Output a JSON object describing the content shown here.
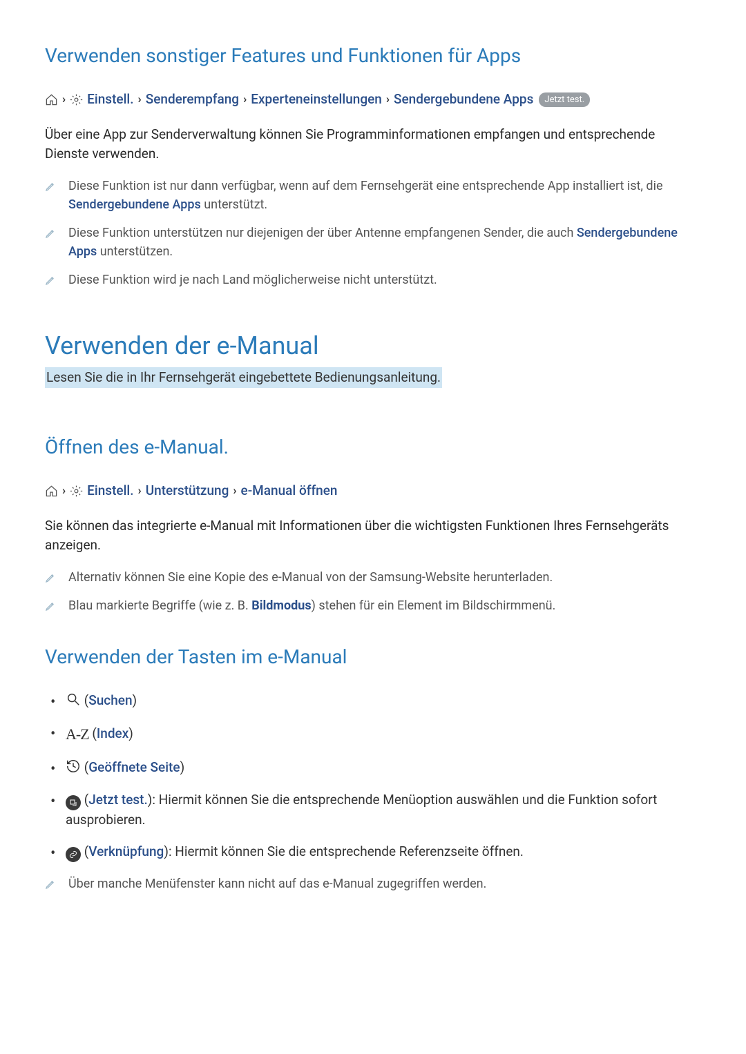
{
  "section1": {
    "title": "Verwenden sonstiger Features und Funktionen für Apps",
    "breadcrumb": {
      "einstell": "Einstell.",
      "senderempfang": "Senderempfang",
      "experten": "Experteneinstellungen",
      "apps": "Sendergebundene Apps",
      "pill": "Jetzt test."
    },
    "body": "Über eine App zur Senderverwaltung können Sie Programminformationen empfangen und entsprechende Dienste verwenden.",
    "notes": {
      "n1_a": "Diese Funktion ist nur dann verfügbar, wenn auf dem Fernsehgerät eine entsprechende App installiert ist, die ",
      "n1_b": "Sendergebundene Apps",
      "n1_c": " unterstützt.",
      "n2_a": "Diese Funktion unterstützen nur diejenigen der über Antenne  empfangenen Sender, die auch ",
      "n2_b": "Sendergebundene Apps",
      "n2_c": " unterstützen.",
      "n3": "Diese Funktion wird je nach Land möglicherweise nicht unterstützt."
    }
  },
  "section2": {
    "title": "Verwenden der e-Manual",
    "subtitle": "Lesen Sie die in Ihr Fernsehgerät eingebettete Bedienungsanleitung."
  },
  "section3": {
    "title": "Öffnen des e-Manual.",
    "breadcrumb": {
      "einstell": "Einstell.",
      "support": "Unterstützung",
      "open": "e-Manual öffnen"
    },
    "body": "Sie können das integrierte e-Manual mit Informationen über die wichtigsten Funktionen Ihres Fernsehgeräts anzeigen.",
    "notes": {
      "n1": "Alternativ können Sie eine Kopie des e-Manual von der Samsung-Website herunterladen.",
      "n2_a": "Blau markierte Begriffe (wie z. B. ",
      "n2_b": "Bildmodus",
      "n2_c": ") stehen für ein Element im Bildschirmmenü."
    }
  },
  "section4": {
    "title": "Verwenden der Tasten im e-Manual",
    "items": {
      "search_label": "Suchen",
      "index_label": "Index",
      "opened_label": "Geöffnete Seite",
      "trynow_label": "Jetzt test.",
      "trynow_desc": ": Hiermit können Sie die entsprechende Menüoption auswählen und die Funktion sofort ausprobieren.",
      "link_label": "Verknüpfung",
      "link_desc": ": Hiermit können Sie die entsprechende Referenzseite öffnen."
    },
    "note": "Über manche Menüfenster kann nicht auf das e-Manual zugegriffen werden."
  }
}
